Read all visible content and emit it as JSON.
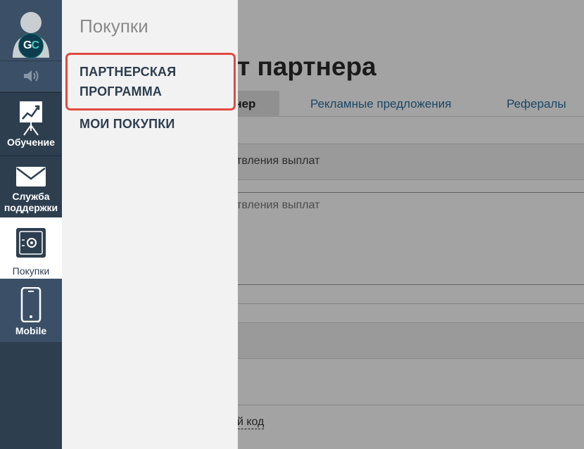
{
  "main": {
    "page_title_fragment": "ет партнера",
    "tabs": [
      {
        "label": "тнер",
        "active": true
      },
      {
        "label": "Рекламные предложения",
        "active": false
      },
      {
        "label": "Рефералы",
        "active": false
      }
    ],
    "section_label": "ствления выплат",
    "field_placeholder": "ствления выплат",
    "code_link": "ий код"
  },
  "sidebar": {
    "profile": {
      "badge_left": "G",
      "badge_right": "C"
    },
    "sound_icon": "speaker-icon",
    "items": [
      {
        "label": "Обучение",
        "icon": "chart-board-icon",
        "active": false
      },
      {
        "label": "Служба поддержки",
        "icon": "envelope-icon",
        "active": false
      },
      {
        "label": "Покупки",
        "icon": "safe-icon",
        "active": true
      },
      {
        "label": "Mobile",
        "icon": "smartphone-icon",
        "active": false
      }
    ]
  },
  "flyout": {
    "title": "Покупки",
    "items": [
      {
        "label": "ПАРТНЕРСКАЯ ПРОГРАММА",
        "highlighted": true
      },
      {
        "label": "МОИ ПОКУПКИ",
        "highlighted": false
      }
    ]
  },
  "colors": {
    "sidebar_bg": "#2d3e4f",
    "sidebar_light": "#3b5067",
    "highlight": "#e04a3f",
    "link": "#2a6f9e"
  }
}
